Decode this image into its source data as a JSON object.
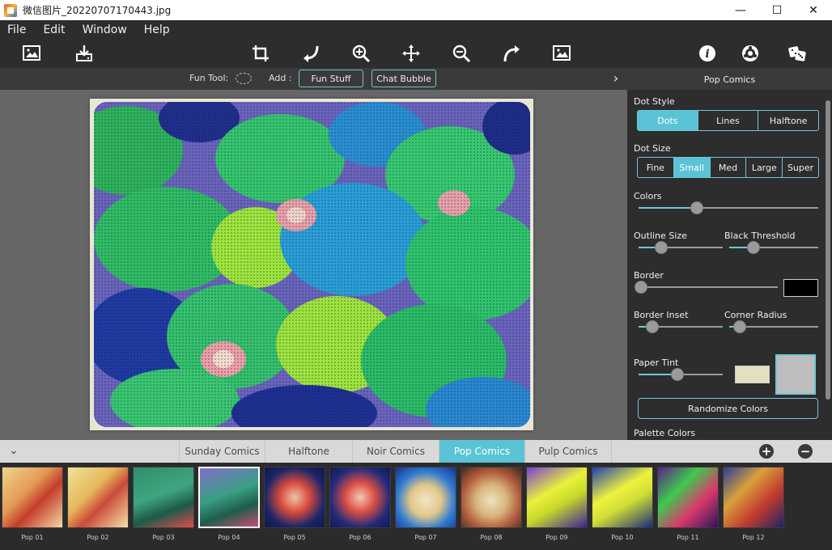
{
  "window": {
    "title": "微信图片_20220707170443.jpg",
    "controls": {
      "minimize": "—",
      "maximize": "☐",
      "close": "✕"
    }
  },
  "menu": [
    "File",
    "Edit",
    "Window",
    "Help"
  ],
  "toolbar": {
    "icons": [
      "open-image-icon",
      "save-icon",
      "crop-icon",
      "rotate-left-icon",
      "zoom-in-icon",
      "pan-icon",
      "zoom-out-icon",
      "rotate-right-icon",
      "fit-image-icon",
      "info-icon",
      "settings-icon",
      "random-dice-icon"
    ]
  },
  "options_bar": {
    "fun_tool_label": "Fun Tool:",
    "add_label": "Add :",
    "fun_stuff_button": "Fun Stuff",
    "chat_bubble_button": "Chat Bubble",
    "expand_chevron": "›"
  },
  "panel": {
    "title": "Pop Comics",
    "dot_style": {
      "label": "Dot Style",
      "options": [
        "Dots",
        "Lines",
        "Halftone"
      ],
      "selected": "Dots"
    },
    "dot_size": {
      "label": "Dot Size",
      "options": [
        "Fine",
        "Small",
        "Med",
        "Large",
        "Super"
      ],
      "selected": "Small"
    },
    "colors": {
      "label": "Colors",
      "value": 0.45
    },
    "outline_size": {
      "label": "Outline Size",
      "value": 0.25
    },
    "black_threshold": {
      "label": "Black Threshold",
      "value": 0.3
    },
    "border": {
      "label": "Border",
      "value": 0.0,
      "color": "#000000"
    },
    "border_inset": {
      "label": "Border Inset",
      "value": 0.15
    },
    "corner_radius": {
      "label": "Corner Radius",
      "value": 0.15
    },
    "paper_tint": {
      "label": "Paper Tint",
      "value": 0.45,
      "color": "#e3dfc0",
      "texture_color": "#bdbdbd"
    },
    "randomize_button": "Randomize Colors",
    "palette_label": "Palette Colors"
  },
  "tabs": {
    "items": [
      "Sunday Comics",
      "Halftone",
      "Noir Comics",
      "Pop Comics",
      "Pulp Comics"
    ],
    "selected": "Pop Comics",
    "add": "+",
    "remove": "−",
    "collapse": "⌄"
  },
  "thumbnails": {
    "labels": [
      "Pop 01",
      "Pop 02",
      "Pop 03",
      "Pop 04",
      "Pop 05",
      "Pop 06",
      "Pop 07",
      "Pop 08",
      "Pop 09",
      "Pop 10",
      "Pop 11",
      "Pop 12"
    ],
    "selected": "Pop 04"
  },
  "colors": {
    "accent": "#5ac3d6",
    "panel_bg": "#2d2d2d",
    "canvas_bg": "#666666"
  }
}
